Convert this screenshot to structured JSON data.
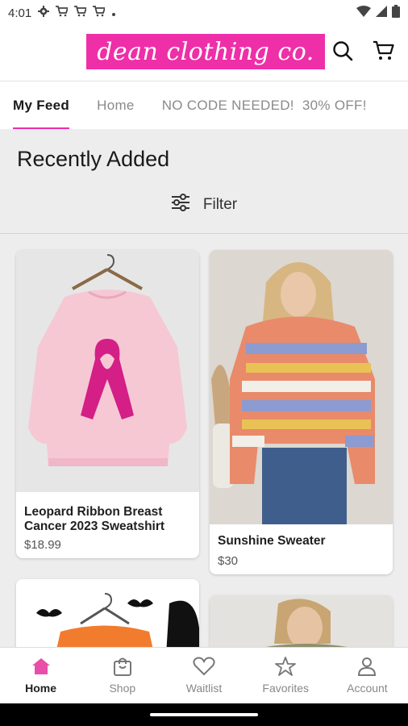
{
  "status_bar": {
    "time": "4:01"
  },
  "header": {
    "logo_text": "dean clothing co.",
    "brand_color": "#ee2fa8"
  },
  "tabs": [
    {
      "label": "My Feed",
      "active": true
    },
    {
      "label": "Home",
      "active": false
    },
    {
      "label": "NO CODE NEEDED!  30% OFF!",
      "active": false
    }
  ],
  "feed": {
    "section_title": "Recently Added",
    "filter_label": "Filter",
    "products": [
      {
        "title": "Leopard Ribbon Breast Cancer 2023 Sweatshirt",
        "price": "$18.99"
      },
      {
        "title": "Sunshine Sweater",
        "price": "$30"
      },
      {
        "title": "",
        "price": ""
      },
      {
        "title": "",
        "price": ""
      }
    ]
  },
  "bottom_nav": [
    {
      "label": "Home",
      "icon": "home-icon",
      "active": true
    },
    {
      "label": "Shop",
      "icon": "shopping-bag-icon",
      "active": false
    },
    {
      "label": "Waitlist",
      "icon": "heart-icon",
      "active": false
    },
    {
      "label": "Favorites",
      "icon": "star-icon",
      "active": false
    },
    {
      "label": "Account",
      "icon": "account-icon",
      "active": false
    }
  ]
}
